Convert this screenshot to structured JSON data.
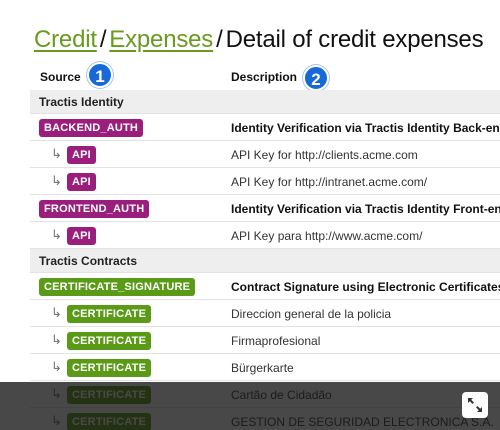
{
  "breadcrumb": {
    "items": [
      "Credit",
      "Expenses"
    ],
    "separator": "/",
    "current": "Detail of credit expenses"
  },
  "table": {
    "headers": {
      "source": "Source",
      "description": "Description"
    },
    "badges": {
      "source": "1",
      "description": "2"
    },
    "groups": [
      {
        "title": "Tractis Identity",
        "color": "#9a1f7d",
        "entries": [
          {
            "tag": "BACKEND_AUTH",
            "desc": "Identity Verification via Tractis Identity Back-end",
            "children": [
              {
                "tag": "API",
                "desc": "API Key for http://clients.acme.com"
              },
              {
                "tag": "API",
                "desc": "API Key for http://intranet.acme.com/"
              }
            ]
          },
          {
            "tag": "FRONTEND_AUTH",
            "desc": "Identity Verification via Tractis Identity Front-end",
            "children": [
              {
                "tag": "API",
                "desc": "API Key para http://www.acme.com/"
              }
            ]
          }
        ]
      },
      {
        "title": "Tractis Contracts",
        "color": "#5a9a16",
        "entries": [
          {
            "tag": "CERTIFICATE_SIGNATURE",
            "desc": "Contract Signature using Electronic Certificates",
            "children": [
              {
                "tag": "CERTIFICATE",
                "desc": "Direccion general de la policia"
              },
              {
                "tag": "CERTIFICATE",
                "desc": "Firmaprofesional"
              },
              {
                "tag": "CERTIFICATE",
                "desc": "Bürgerkarte"
              },
              {
                "tag": "CERTIFICATE",
                "desc": "Cartão de Cidadão"
              },
              {
                "tag": "CERTIFICATE",
                "desc": "GESTION DE SEGURIDAD ELECTRONICA S.A."
              }
            ]
          }
        ]
      }
    ]
  },
  "overlay": {
    "expand_icon": "expand-icon"
  },
  "child_arrow": "↳"
}
